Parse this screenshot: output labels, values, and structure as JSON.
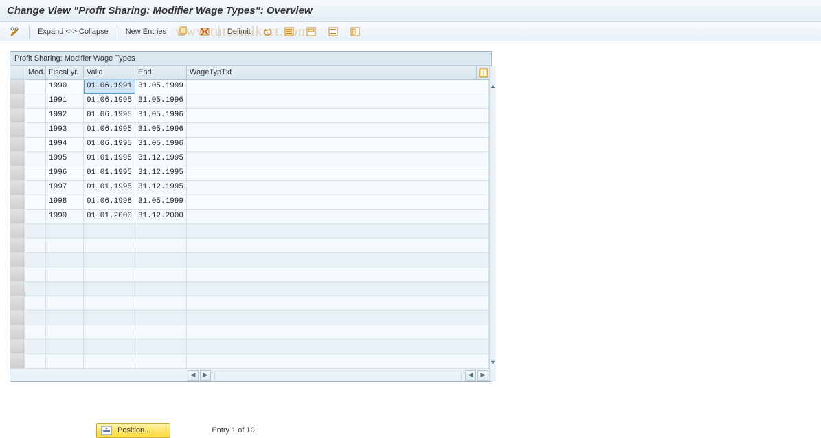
{
  "title": "Change View \"Profit Sharing: Modifier Wage Types\": Overview",
  "toolbar": {
    "expand_label": "Expand <-> Collapse",
    "new_entries_label": "New Entries",
    "delimit_label": "Delimit"
  },
  "table": {
    "caption": "Profit Sharing: Modifier Wage Types",
    "columns": {
      "mod": "Mod.",
      "fiscal": "Fiscal yr.",
      "valid": "Valid",
      "end": "End",
      "wagetxt": "WageTypTxt"
    },
    "rows": [
      {
        "mod": "",
        "fiscal": "1990",
        "valid": "01.06.1991",
        "end": "31.05.1999",
        "wagetxt": ""
      },
      {
        "mod": "",
        "fiscal": "1991",
        "valid": "01.06.1995",
        "end": "31.05.1996",
        "wagetxt": ""
      },
      {
        "mod": "",
        "fiscal": "1992",
        "valid": "01.06.1995",
        "end": "31.05.1996",
        "wagetxt": ""
      },
      {
        "mod": "",
        "fiscal": "1993",
        "valid": "01.06.1995",
        "end": "31.05.1996",
        "wagetxt": ""
      },
      {
        "mod": "",
        "fiscal": "1994",
        "valid": "01.06.1995",
        "end": "31.05.1996",
        "wagetxt": ""
      },
      {
        "mod": "",
        "fiscal": "1995",
        "valid": "01.01.1995",
        "end": "31.12.1995",
        "wagetxt": ""
      },
      {
        "mod": "",
        "fiscal": "1996",
        "valid": "01.01.1995",
        "end": "31.12.1995",
        "wagetxt": ""
      },
      {
        "mod": "",
        "fiscal": "1997",
        "valid": "01.01.1995",
        "end": "31.12.1995",
        "wagetxt": ""
      },
      {
        "mod": "",
        "fiscal": "1998",
        "valid": "01.06.1998",
        "end": "31.05.1999",
        "wagetxt": ""
      },
      {
        "mod": "",
        "fiscal": "1999",
        "valid": "01.01.2000",
        "end": "31.12.2000",
        "wagetxt": ""
      }
    ],
    "selected_row": 0,
    "selected_col": "valid",
    "empty_rows": 10
  },
  "footer": {
    "position_label": "Position...",
    "entry_label": "Entry 1 of 10"
  },
  "watermark": "www.tutorialkart.com"
}
